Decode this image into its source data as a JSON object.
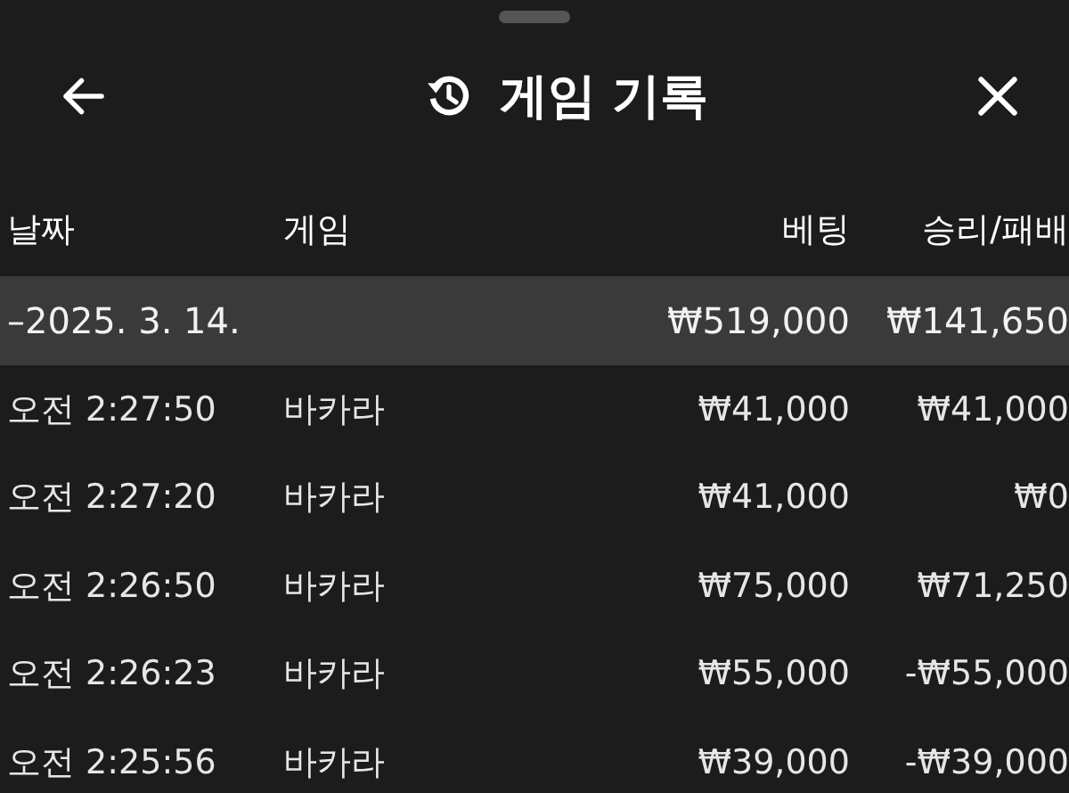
{
  "header": {
    "title": "게임 기록"
  },
  "table": {
    "columns": [
      "날짜",
      "게임",
      "베팅",
      "승리/패배"
    ],
    "group": {
      "date": "–2025. 3. 14.",
      "bet": "₩519,000",
      "result": "₩141,650"
    },
    "rows": [
      {
        "time": "오전 2:27:50",
        "game": "바카라",
        "bet": "₩41,000",
        "result": "₩41,000"
      },
      {
        "time": "오전 2:27:20",
        "game": "바카라",
        "bet": "₩41,000",
        "result": "₩0"
      },
      {
        "time": "오전 2:26:50",
        "game": "바카라",
        "bet": "₩75,000",
        "result": "₩71,250"
      },
      {
        "time": "오전 2:26:23",
        "game": "바카라",
        "bet": "₩55,000",
        "result": "-₩55,000"
      },
      {
        "time": "오전 2:25:56",
        "game": "바카라",
        "bet": "₩39,000",
        "result": "-₩39,000"
      }
    ]
  }
}
